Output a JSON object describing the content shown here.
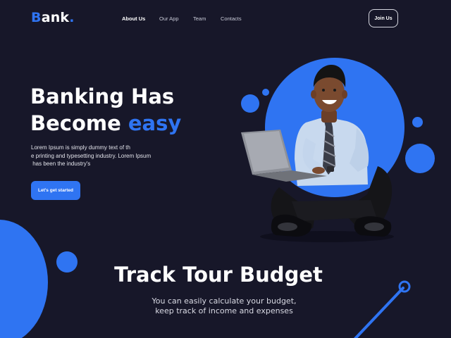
{
  "logo": {
    "first": "B",
    "rest": "ank",
    "dot": "."
  },
  "nav": {
    "items": [
      {
        "label": "About Us",
        "active": true
      },
      {
        "label": "Our App",
        "active": false
      },
      {
        "label": "Team",
        "active": false
      },
      {
        "label": "Contacts",
        "active": false
      }
    ],
    "join_label": "Join Us"
  },
  "hero": {
    "title_line1": "Banking Has",
    "title_line2_plain": "Become ",
    "title_line2_accent": "easy",
    "desc_lines": [
      "Lorem Ipsum is simply dummy text of th",
      "e printing and typesetting industry. Lorem Ipsum",
      " has been the industry's"
    ],
    "cta_label": "Let's get started",
    "image": "smiling-man-with-laptop-illustration"
  },
  "section": {
    "title": "Track Tour Budget",
    "desc_lines": [
      "You can easily calculate your budget,",
      "keep track of income and expenses"
    ]
  },
  "colors": {
    "background": "#171729",
    "accent": "#2f74f2",
    "text": "#ffffff"
  }
}
